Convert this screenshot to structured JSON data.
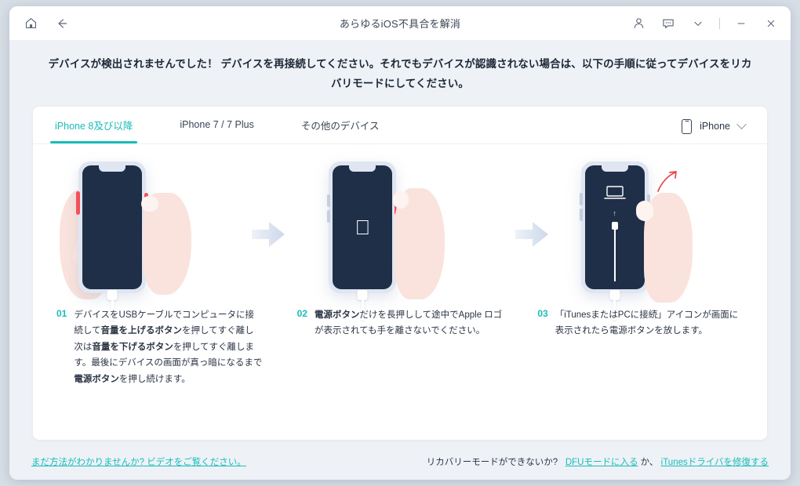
{
  "titlebar": {
    "home_icon": "home-icon",
    "back_icon": "back-arrow-icon",
    "title": "あらゆるiOS不具合を解消",
    "account_icon": "account-icon",
    "feedback_icon": "chat-bubble-icon",
    "more_icon": "chevron-down-icon",
    "minimize_icon": "minimize-icon",
    "close_icon": "close-icon"
  },
  "heading": {
    "text": "デバイスが検出されませんでした！ デバイスを再接続してください。それでもデバイスが認識されない場合は、以下の手順に従ってデバイスをリカバリモードにしてください。"
  },
  "tabs": [
    {
      "label": "iPhone 8及び以降",
      "active": true
    },
    {
      "label": "iPhone 7 / 7 Plus",
      "active": false
    },
    {
      "label": "その他のデバイス",
      "active": false
    }
  ],
  "device_select": {
    "icon": "phone-icon",
    "value": "iPhone",
    "chevron": "chevron-down-icon"
  },
  "steps": [
    {
      "number": "01",
      "parts": [
        {
          "text": "デバイスをUSBケーブルでコンピュータに接続して",
          "bold": false
        },
        {
          "text": "音量を上げるボタン",
          "bold": true
        },
        {
          "text": "を押してすぐ離し次は",
          "bold": false
        },
        {
          "text": "音量を下げるボタン",
          "bold": true
        },
        {
          "text": "を押してすぐ離します。最後にデバイスの画面が真っ暗になるまで",
          "bold": false
        },
        {
          "text": "電源ボタン",
          "bold": true
        },
        {
          "text": "を押し続けます。",
          "bold": false
        }
      ]
    },
    {
      "number": "02",
      "parts": [
        {
          "text": "電源ボタン",
          "bold": true
        },
        {
          "text": "だけを長押しして途中でApple ロゴが表示されても手を離さないでください。",
          "bold": false
        }
      ]
    },
    {
      "number": "03",
      "parts": [
        {
          "text": "「iTunesまたはPCに接続」アイコンが画面に表示されたら電源ボタンを放します。",
          "bold": false
        }
      ]
    }
  ],
  "illustrations": [
    {
      "name": "phone-two-hands-blank-screen",
      "arrow_after": true
    },
    {
      "name": "phone-hand-apple-logo",
      "arrow_after": true
    },
    {
      "name": "phone-hand-release-connect-to-itunes",
      "arrow_after": false
    }
  ],
  "footer": {
    "left_link": "まだ方法がわかりませんか? ビデオをご覧ください。",
    "right_text_before": "リカバリーモードができないか?",
    "right_link_1": "DFUモードに入る",
    "right_text_middle": "か、",
    "right_link_2": "iTunesドライバを修復する"
  },
  "colors": {
    "accent": "#18bdba",
    "page_bg": "#eef2f7",
    "card_bg": "#ffffff",
    "text": "#2b3545",
    "phone_screen": "#1f2f47",
    "button_red": "#f4505a"
  }
}
